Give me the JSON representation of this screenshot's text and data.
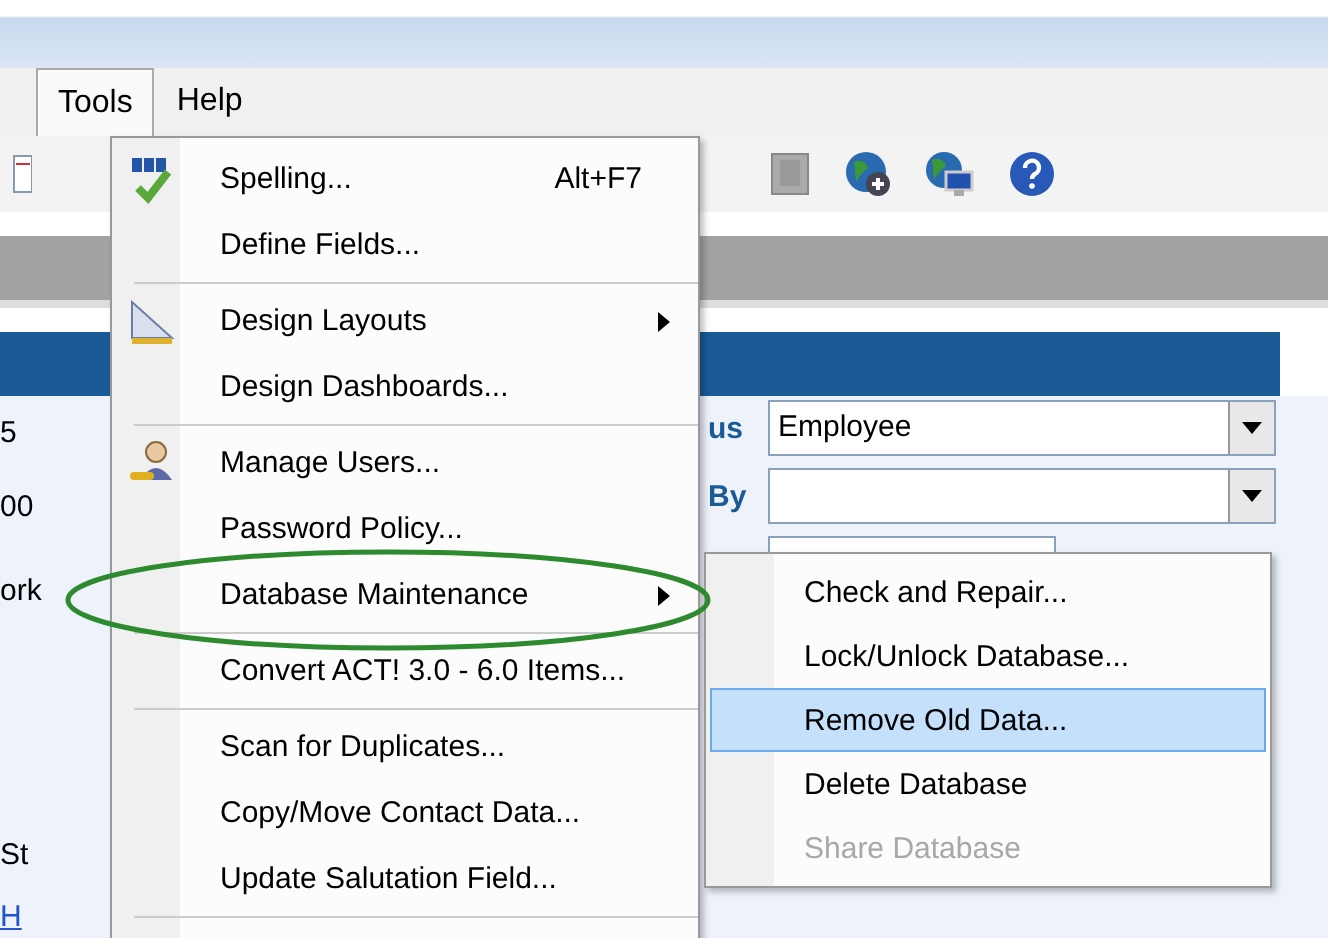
{
  "menubar": [
    {
      "label": "Tools",
      "selected": true
    },
    {
      "label": "Help",
      "selected": false
    }
  ],
  "form": {
    "fragments": [
      {
        "text": "5",
        "kind": "text"
      },
      {
        "text": "00",
        "kind": "text"
      },
      {
        "text": "ork",
        "kind": "text"
      },
      {
        "text": "St",
        "kind": "text"
      },
      {
        "text": "H",
        "kind": "link"
      }
    ],
    "fields": [
      {
        "label": "us",
        "value": "Employee"
      },
      {
        "label": "By"
      }
    ]
  },
  "menu": {
    "items": [
      {
        "kind": "item",
        "label": "Spelling...",
        "shortcut": "Alt+F7",
        "submenu": false
      },
      {
        "kind": "item",
        "label": "Define Fields...",
        "submenu": false
      },
      {
        "kind": "separator"
      },
      {
        "kind": "item",
        "label": "Design Layouts",
        "submenu": true
      },
      {
        "kind": "item",
        "label": "Design Dashboards...",
        "submenu": false
      },
      {
        "kind": "separator"
      },
      {
        "kind": "item",
        "label": "Manage Users...",
        "submenu": false
      },
      {
        "kind": "item",
        "label": "Password Policy...",
        "submenu": false
      },
      {
        "kind": "item",
        "label": "Database Maintenance",
        "submenu": true
      },
      {
        "kind": "separator"
      },
      {
        "kind": "item",
        "label": "Convert ACT! 3.0 - 6.0 Items...",
        "submenu": false
      },
      {
        "kind": "separator"
      },
      {
        "kind": "item",
        "label": "Scan for Duplicates...",
        "submenu": false
      },
      {
        "kind": "item",
        "label": "Copy/Move Contact Data...",
        "submenu": false
      },
      {
        "kind": "item",
        "label": "Update Salutation Field...",
        "submenu": false
      },
      {
        "kind": "separator"
      }
    ]
  },
  "submenu": {
    "items": [
      {
        "label": "Check and Repair...",
        "selected": false,
        "disabled": false
      },
      {
        "label": "Lock/Unlock Database...",
        "selected": false,
        "disabled": false
      },
      {
        "label": "Remove Old Data...",
        "selected": true,
        "disabled": false
      },
      {
        "label": "Delete Database",
        "selected": false,
        "disabled": false
      },
      {
        "label": "Share Database",
        "selected": false,
        "disabled": true
      }
    ]
  }
}
